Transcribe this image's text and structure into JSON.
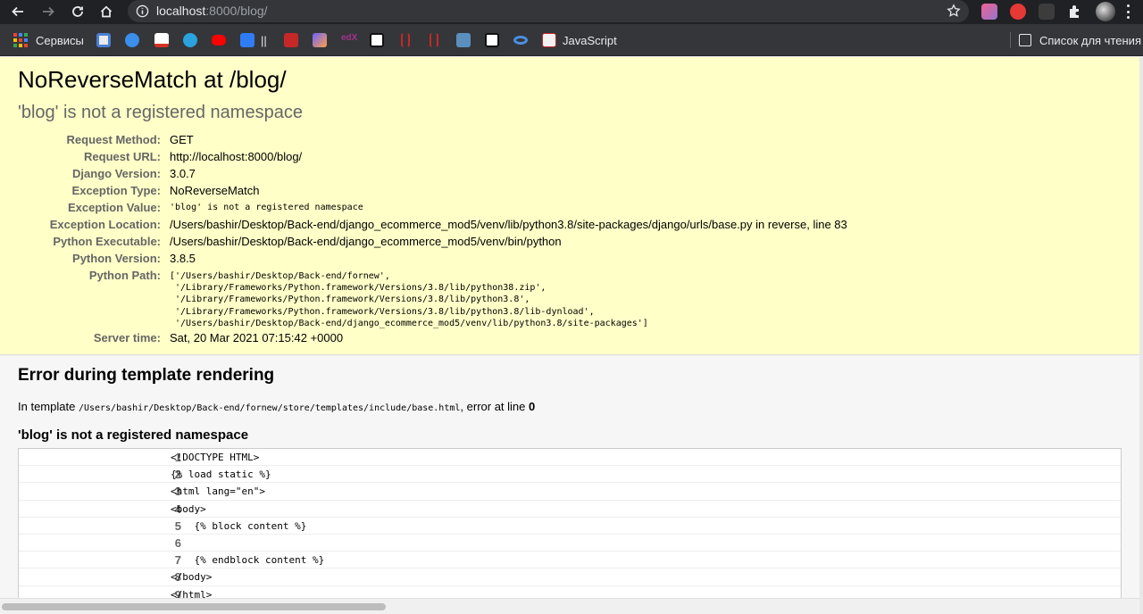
{
  "browser": {
    "url_host": "localhost",
    "url_path": ":8000/blog/",
    "bookmarks": [
      {
        "label": "Сервисы",
        "icon": "apps-grid-icon"
      },
      {
        "label": "",
        "icon": "search-bookmark-icon",
        "color": "#4a7fd4"
      },
      {
        "label": "",
        "icon": "at-sign-icon",
        "color": "#3b8eea"
      },
      {
        "label": "",
        "icon": "gmail-icon",
        "color": "#d93025"
      },
      {
        "label": "",
        "icon": "telegram-icon",
        "color": "#2aa3df"
      },
      {
        "label": "",
        "icon": "youtube-icon",
        "color": "#ff0000"
      },
      {
        "label": "||",
        "icon": "chat-icon",
        "color": "#2f7cf6"
      },
      {
        "label": "",
        "icon": "building-icon",
        "color": "#c62828"
      },
      {
        "label": "",
        "icon": "photo-icon",
        "color": "#6c63ff"
      },
      {
        "label": "",
        "icon": "edx-icon",
        "color": "#a2338d"
      },
      {
        "label": "",
        "icon": "codepen-icon",
        "color": "#ffffff"
      },
      {
        "label": "",
        "icon": "tower-icon",
        "color": "#c62828"
      },
      {
        "label": "",
        "icon": "tower-icon",
        "color": "#c62828"
      },
      {
        "label": "",
        "icon": "bridge-icon",
        "color": "#5a8fbf"
      },
      {
        "label": "",
        "icon": "codepen-icon",
        "color": "#ffffff"
      },
      {
        "label": "",
        "icon": "infinity-icon",
        "color": "#4a90e2"
      },
      {
        "label": "JavaScript",
        "icon": "js-icon",
        "color": "#f2f2f2"
      }
    ],
    "reading_list_label": "Список для чтения"
  },
  "error": {
    "title": "NoReverseMatch at /blog/",
    "subtitle": "'blog' is not a registered namespace",
    "meta": [
      {
        "key": "Request Method:",
        "value": "GET"
      },
      {
        "key": "Request URL:",
        "value": "http://localhost:8000/blog/"
      },
      {
        "key": "Django Version:",
        "value": "3.0.7"
      },
      {
        "key": "Exception Type:",
        "value": "NoReverseMatch"
      },
      {
        "key": "Exception Value:",
        "value": "'blog' is not a registered namespace"
      },
      {
        "key": "Exception Location:",
        "value": "/Users/bashir/Desktop/Back-end/django_ecommerce_mod5/venv/lib/python3.8/site-packages/django/urls/base.py in reverse, line 83"
      },
      {
        "key": "Python Executable:",
        "value": "/Users/bashir/Desktop/Back-end/django_ecommerce_mod5/venv/bin/python"
      },
      {
        "key": "Python Version:",
        "value": "3.8.5"
      },
      {
        "key": "Python Path:",
        "value": ""
      },
      {
        "key": "Server time:",
        "value": "Sat, 20 Mar 2021 07:15:42 +0000"
      }
    ],
    "python_path": [
      "['/Users/bashir/Desktop/Back-end/fornew',",
      " '/Library/Frameworks/Python.framework/Versions/3.8/lib/python38.zip',",
      " '/Library/Frameworks/Python.framework/Versions/3.8/lib/python3.8',",
      " '/Library/Frameworks/Python.framework/Versions/3.8/lib/python3.8/lib-dynload',",
      " '/Users/bashir/Desktop/Back-end/django_ecommerce_mod5/venv/lib/python3.8/site-packages']"
    ]
  },
  "template_error": {
    "heading": "Error during template rendering",
    "in_template_prefix": "In template ",
    "template_path": "/Users/bashir/Desktop/Back-end/fornew/store/templates/include/base.html",
    "error_at_line_text": ", error at line ",
    "error_line": "0",
    "message": "'blog' is not a registered namespace",
    "source_lines": [
      {
        "num": "1",
        "code": "<!DOCTYPE HTML>"
      },
      {
        "num": "2",
        "code": "{% load static %}"
      },
      {
        "num": "3",
        "code": "<html lang=\"en\">"
      },
      {
        "num": "4",
        "code": "<body>"
      },
      {
        "num": "5",
        "code": "    {% block content %}"
      },
      {
        "num": "6",
        "code": ""
      },
      {
        "num": "7",
        "code": "    {% endblock content %}"
      },
      {
        "num": "8",
        "code": "</body>"
      },
      {
        "num": "9",
        "code": "</html>"
      }
    ]
  }
}
